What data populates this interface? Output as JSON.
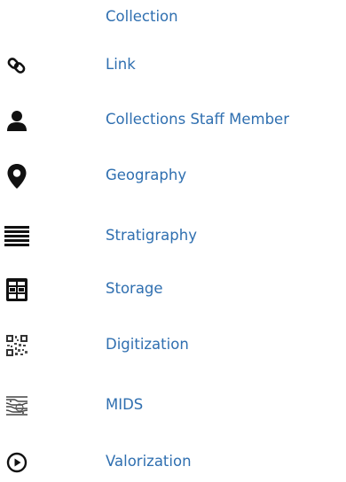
{
  "menu": {
    "items": [
      {
        "label": "Collection",
        "icon": "none"
      },
      {
        "label": "Link",
        "icon": "link-icon"
      },
      {
        "label": "Collections Staff Member",
        "icon": "person-icon"
      },
      {
        "label": "Geography",
        "icon": "map-pin-icon"
      },
      {
        "label": "Stratigraphy",
        "icon": "stratigraphy-icon"
      },
      {
        "label": "Storage",
        "icon": "storage-icon"
      },
      {
        "label": "Digitization",
        "icon": "qr-code-icon"
      },
      {
        "label": "MIDS",
        "icon": "mids-icon"
      },
      {
        "label": "Valorization",
        "icon": "play-circle-icon"
      }
    ]
  },
  "colors": {
    "label": "#2f6fb0",
    "icon": "#111111"
  }
}
